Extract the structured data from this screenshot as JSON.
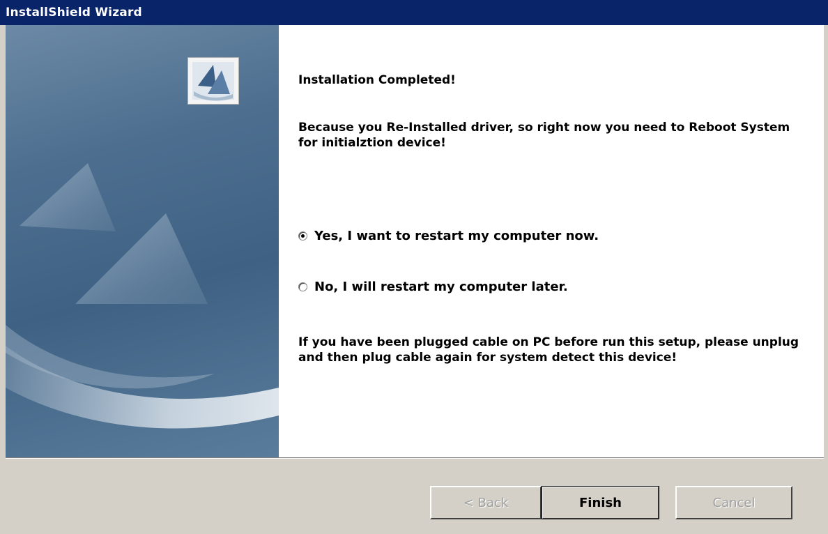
{
  "window": {
    "title": "InstallShield Wizard"
  },
  "content": {
    "heading": "Installation Completed!",
    "paragraph1": "Because you Re-Installed driver, so right now you need to Reboot System for initialztion device!",
    "options": [
      {
        "label": "Yes, I want to restart my computer now.",
        "selected": true
      },
      {
        "label": "No, I will restart my computer later.",
        "selected": false
      }
    ],
    "paragraph2": "If you have been plugged cable on PC before run this setup, please unplug and then plug cable again for system detect this device!"
  },
  "buttons": {
    "back": {
      "label": "< Back",
      "enabled": false
    },
    "finish": {
      "label": "Finish",
      "enabled": true
    },
    "cancel": {
      "label": "Cancel",
      "enabled": false
    }
  },
  "colors": {
    "title_bar": "#0a246a",
    "dialog_face": "#d4d0c8",
    "banner": "#4d6e8f"
  },
  "icons": [
    "installshield-logo-icon",
    "radio-checked-icon",
    "radio-unchecked-icon"
  ]
}
